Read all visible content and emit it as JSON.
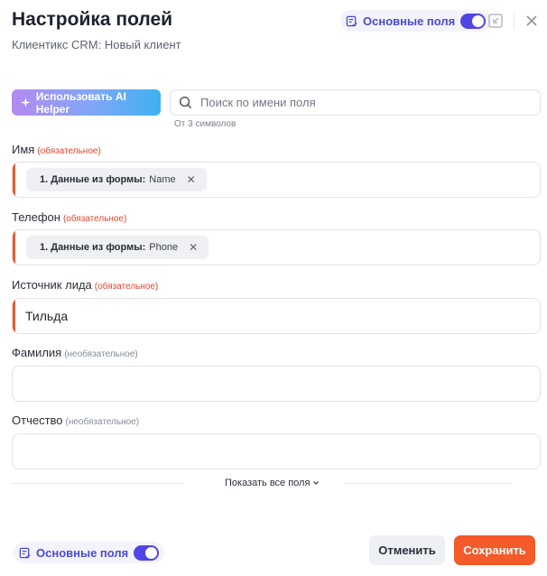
{
  "header": {
    "title": "Настройка полей",
    "subtitle": "Клиентикс CRM: Новый клиент"
  },
  "main_fields_toggle": {
    "label": "Основные поля",
    "enabled": true
  },
  "toolbar": {
    "ai_button_label": "Использовать AI Helper"
  },
  "search": {
    "placeholder": "Поиск по имени поля",
    "value": "",
    "hint": "От 3 символов"
  },
  "fields": [
    {
      "label": "Имя",
      "requirement": "(обязательное)",
      "required": true,
      "chip_prefix": "1. Данные из формы:",
      "chip_value": "Name"
    },
    {
      "label": "Телефон",
      "requirement": "(обязательное)",
      "required": true,
      "chip_prefix": "1. Данные из формы:",
      "chip_value": "Phone"
    },
    {
      "label": "Источник лида",
      "requirement": "(обязательное)",
      "required": true,
      "value": "Тильда"
    },
    {
      "label": "Фамилия",
      "requirement": "(необязательное)",
      "required": false,
      "value": ""
    },
    {
      "label": "Отчество",
      "requirement": "(необязательное)",
      "required": false,
      "value": ""
    }
  ],
  "show_all": {
    "label": "Показать все поля"
  },
  "footer": {
    "cancel_label": "Отменить",
    "save_label": "Сохранить"
  },
  "colors": {
    "accent": "#5046e5",
    "required_marker": "#ec5b2b",
    "save_button": "#f45a2a",
    "required_text": "#e5452e"
  },
  "icons": {
    "toggle": "fields-list-icon",
    "collapse": "collapse-icon",
    "close": "close-icon",
    "ai": "sparkles-icon",
    "search": "search-icon",
    "chip_remove": "remove-icon",
    "show_all": "chevron-down-icon"
  }
}
